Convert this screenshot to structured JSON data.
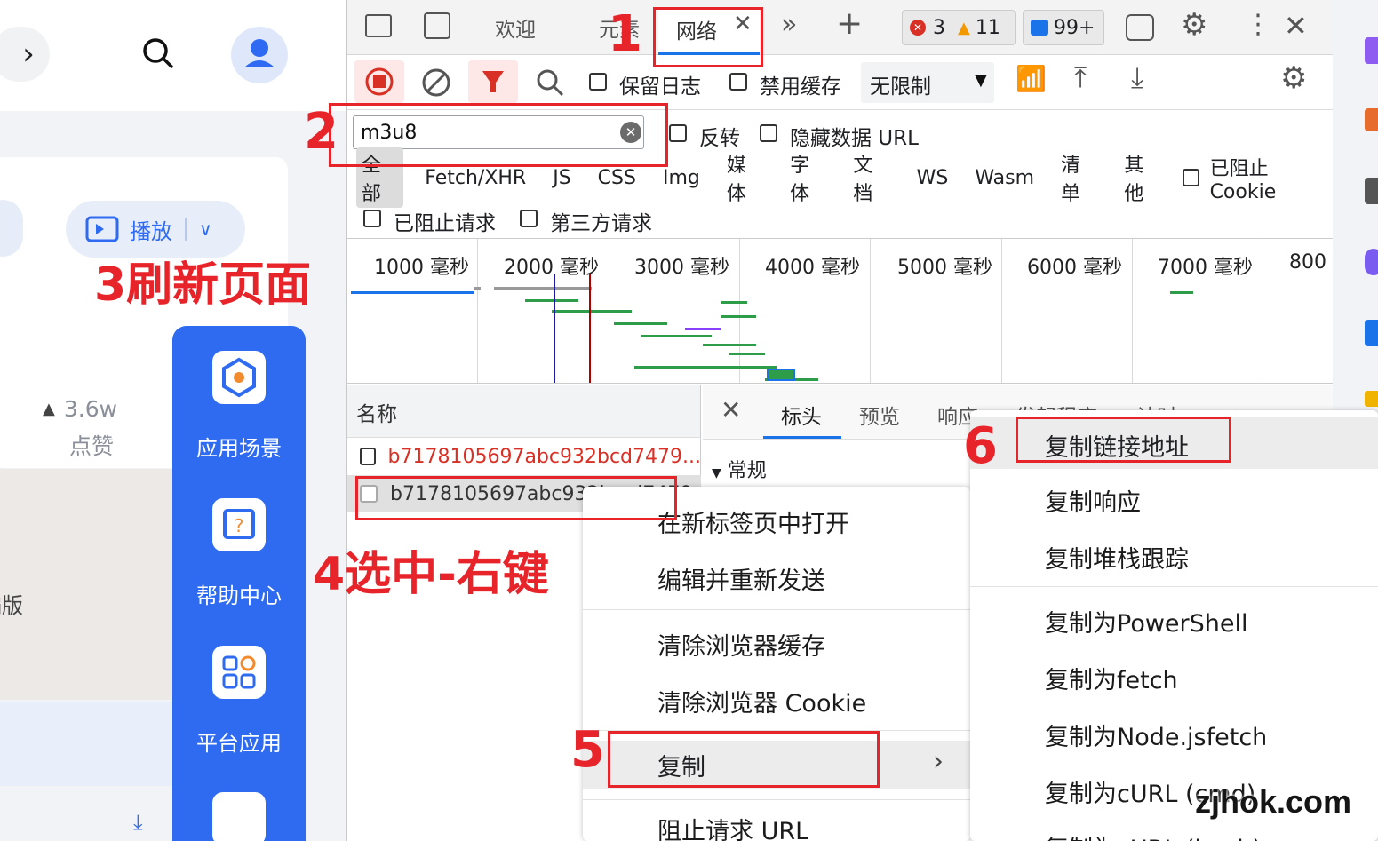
{
  "website": {
    "play_label": "播放",
    "likes_count": "3.6w",
    "likes_label": "点赞",
    "side_label_partial": "编版",
    "side_menu": [
      {
        "label": "应用场景",
        "icon": "hexagon-icon"
      },
      {
        "label": "帮助中心",
        "icon": "help-icon"
      },
      {
        "label": "平台应用",
        "icon": "grid-icon"
      }
    ]
  },
  "devtools": {
    "tabs": {
      "welcome": "欢迎",
      "elements": "元素",
      "network": "网络"
    },
    "counts": {
      "errors": "3",
      "warnings": "11",
      "messages": "99+"
    },
    "toolbar": {
      "preserve_log": "保留日志",
      "disable_cache": "禁用缓存",
      "throttle": "无限制"
    },
    "filter": {
      "value": "m3u8",
      "invert": "反转",
      "hide_data_urls": "隐藏数据 URL",
      "types": [
        "全部",
        "Fetch/XHR",
        "JS",
        "CSS",
        "Img",
        "媒体",
        "字体",
        "文档",
        "WS",
        "Wasm",
        "清单",
        "其他"
      ],
      "blocked_cookies": "已阻止 Cookie",
      "blocked_requests": "已阻止请求",
      "third_party": "第三方请求"
    },
    "timeline_labels": [
      "1000 毫秒",
      "2000 毫秒",
      "3000 毫秒",
      "4000 毫秒",
      "5000 毫秒",
      "6000 毫秒",
      "7000 毫秒",
      "800"
    ],
    "requests": {
      "header": "名称",
      "rows": [
        "b7178105697abc932bcd7479...",
        "b7178105697abc932b...d7479"
      ]
    },
    "detail_tabs": [
      "标头",
      "预览",
      "响应",
      "发起程序",
      "计时"
    ],
    "section_general": "常规"
  },
  "context_menu": {
    "items": [
      "在新标签页中打开",
      "编辑并重新发送",
      "清除浏览器缓存",
      "清除浏览器 Cookie",
      "复制",
      "阻止请求 URL"
    ],
    "submenu": [
      "复制链接地址",
      "复制响应",
      "复制堆栈跟踪",
      "复制为PowerShell",
      "复制为fetch",
      "复制为Node.jsfetch",
      "复制为cURL (cmd)",
      "复制为cURL (bash)"
    ]
  },
  "annotations": {
    "step1": "1",
    "step2": "2",
    "step3": "3刷新页面",
    "step4": "4选中-右键",
    "step5": "5",
    "step6": "6"
  },
  "watermark": "zjhok.com",
  "colors": {
    "accent_blue": "#2e6bf0",
    "annotation_red": "#e8242b",
    "request_red": "#d93025"
  }
}
